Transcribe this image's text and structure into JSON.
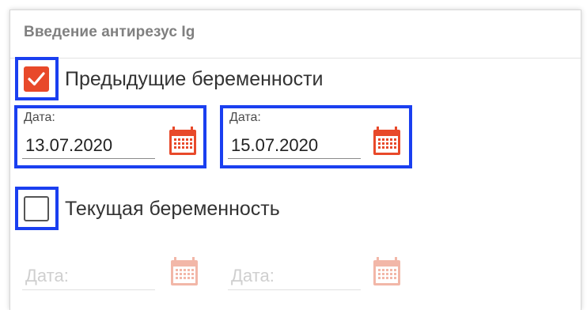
{
  "section": {
    "title": "Введение антирезус Ig"
  },
  "previous_pregnancies": {
    "checked": true,
    "label": "Предыдущие беременности",
    "date_from": {
      "label": "Дата:",
      "value": "13.07.2020"
    },
    "date_to": {
      "label": "Дата:",
      "value": "15.07.2020"
    }
  },
  "current_pregnancy": {
    "checked": false,
    "label": "Текущая беременность",
    "date_from": {
      "placeholder": "Дата:"
    },
    "date_to": {
      "placeholder": "Дата:"
    }
  },
  "icons": {
    "date_picker": "calendar-icon",
    "check": "checkmark-icon"
  },
  "colors": {
    "accent": "#e8492a",
    "highlight": "#1a3ff0",
    "muted": "#808080"
  }
}
